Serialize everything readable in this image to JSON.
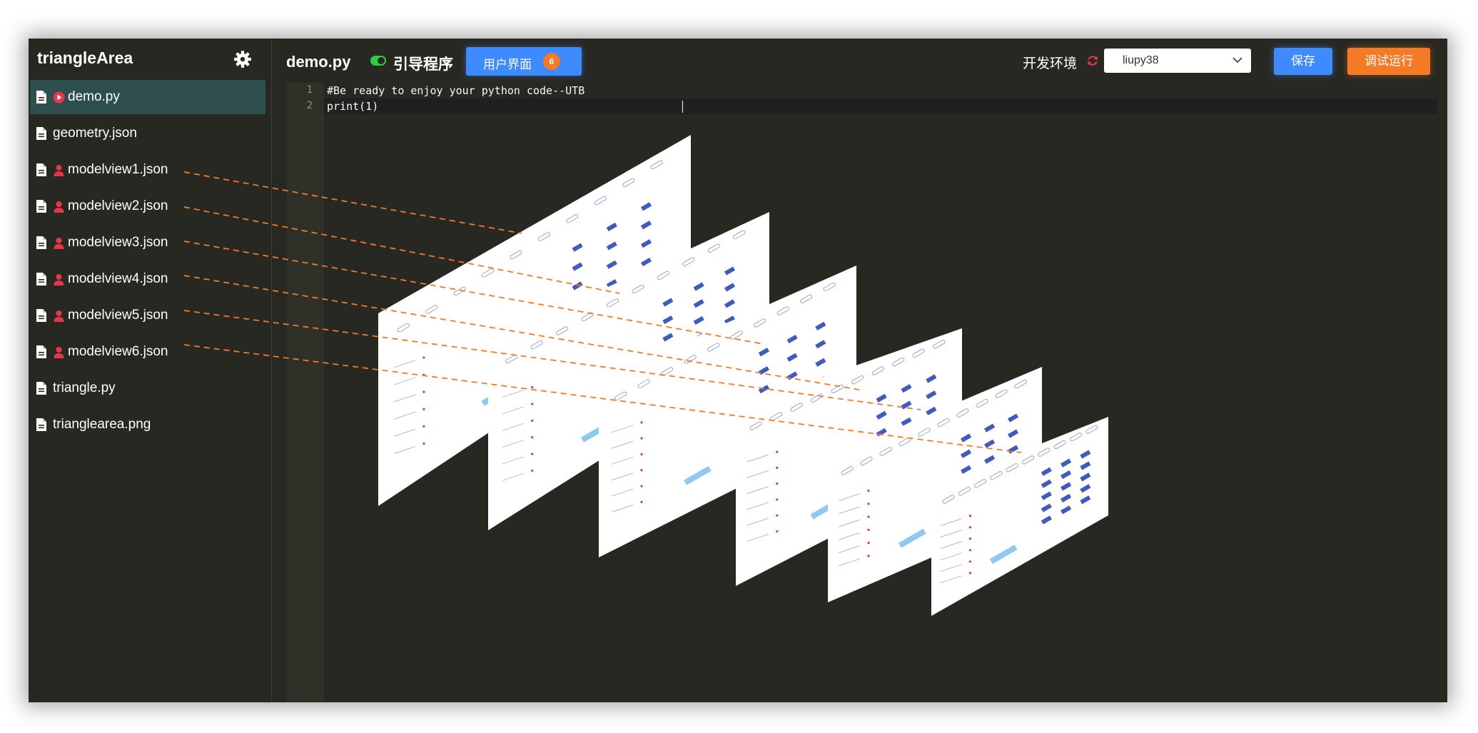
{
  "sidebar": {
    "project_title": "triangleArea",
    "settings_icon": "gear-icon",
    "files": [
      {
        "name": "demo.py",
        "badge": "run",
        "active": true
      },
      {
        "name": "geometry.json",
        "badge": "",
        "active": false
      },
      {
        "name": "modelview1.json",
        "badge": "user",
        "active": false
      },
      {
        "name": "modelview2.json",
        "badge": "user",
        "active": false
      },
      {
        "name": "modelview3.json",
        "badge": "user",
        "active": false
      },
      {
        "name": "modelview4.json",
        "badge": "user",
        "active": false
      },
      {
        "name": "modelview5.json",
        "badge": "user",
        "active": false
      },
      {
        "name": "modelview6.json",
        "badge": "user",
        "active": false
      },
      {
        "name": "triangle.py",
        "badge": "",
        "active": false
      },
      {
        "name": "trianglearea.png",
        "badge": "",
        "active": false
      }
    ]
  },
  "topbar": {
    "file_title": "demo.py",
    "guide_label": "引导程序",
    "guide_enabled": true,
    "ui_button_label": "用户界面",
    "ui_count": "6",
    "env_label": "开发环境",
    "env_value": "liupy38",
    "save_label": "保存",
    "run_label": "调试运行"
  },
  "editor": {
    "lines": [
      {
        "num": "1",
        "text": "#Be ready to enjoy your python code--UTB"
      },
      {
        "num": "2",
        "text": "print(1)"
      }
    ]
  },
  "colors": {
    "background": "#272822",
    "accent_blue": "#3d8bff",
    "accent_orange": "#f57a25",
    "active_file_bg": "#2f4f4f",
    "badge_red": "#e8354b",
    "toggle_green": "#2ecc40"
  }
}
